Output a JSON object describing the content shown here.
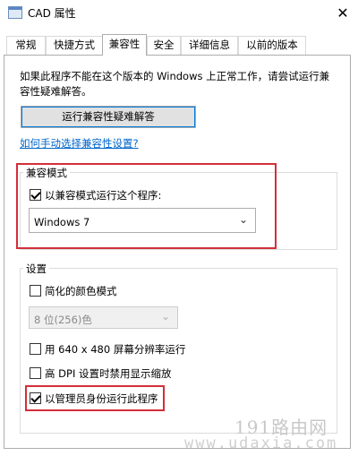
{
  "window": {
    "title": "CAD 属性",
    "close_label": "✕"
  },
  "tabs": [
    {
      "label": "常规"
    },
    {
      "label": "快捷方式"
    },
    {
      "label": "兼容性"
    },
    {
      "label": "安全"
    },
    {
      "label": "详细信息"
    },
    {
      "label": "以前的版本"
    }
  ],
  "compat": {
    "description": "如果此程序不能在这个版本的 Windows 上正常工作，请尝试运行兼容性疑难解答。",
    "troubleshoot_button": "运行兼容性疑难解答",
    "manual_link": "如何手动选择兼容性设置?",
    "mode_group_label": "兼容模式",
    "mode_checkbox_label": "以兼容模式运行这个程序:",
    "mode_checked": true,
    "mode_select_value": "Windows 7"
  },
  "settings": {
    "group_label": "设置",
    "reduced_color_label": "简化的颜色模式",
    "reduced_color_checked": false,
    "color_select_value": "8 位(256)色",
    "res_640_label": "用 640 x 480 屏幕分辨率运行",
    "res_640_checked": false,
    "high_dpi_label": "高 DPI 设置时禁用显示缩放",
    "high_dpi_checked": false,
    "admin_label": "以管理员身份运行此程序",
    "admin_checked": true
  },
  "watermark": {
    "site_name": "191路由网",
    "site_url": "www.udaxia.com"
  },
  "colors": {
    "highlight_border": "#d32f3a",
    "link": "#0066cc",
    "focus": "#0078d7"
  }
}
